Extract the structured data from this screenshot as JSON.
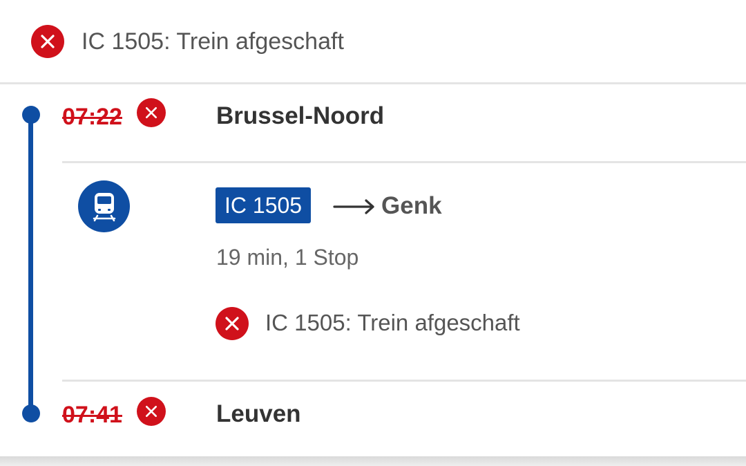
{
  "banner": {
    "message": "IC 1505: Trein afgeschaft",
    "icon": "cancel-circle-icon"
  },
  "journey": {
    "departure": {
      "time": "07:22",
      "station": "Brussel-Noord",
      "status_icon": "cancel-circle-icon"
    },
    "leg": {
      "mode_icon": "train-icon",
      "train": "IC 1505",
      "direction_icon": "arrow-right-icon",
      "destination": "Genk",
      "duration": "19 min, 1 Stop",
      "notice": "IC 1505: Trein afgeschaft"
    },
    "arrival": {
      "time": "07:41",
      "station": "Leuven",
      "status_icon": "cancel-circle-icon"
    }
  },
  "colors": {
    "cancel": "#d0111b",
    "brand_blue": "#0f4ea3"
  }
}
